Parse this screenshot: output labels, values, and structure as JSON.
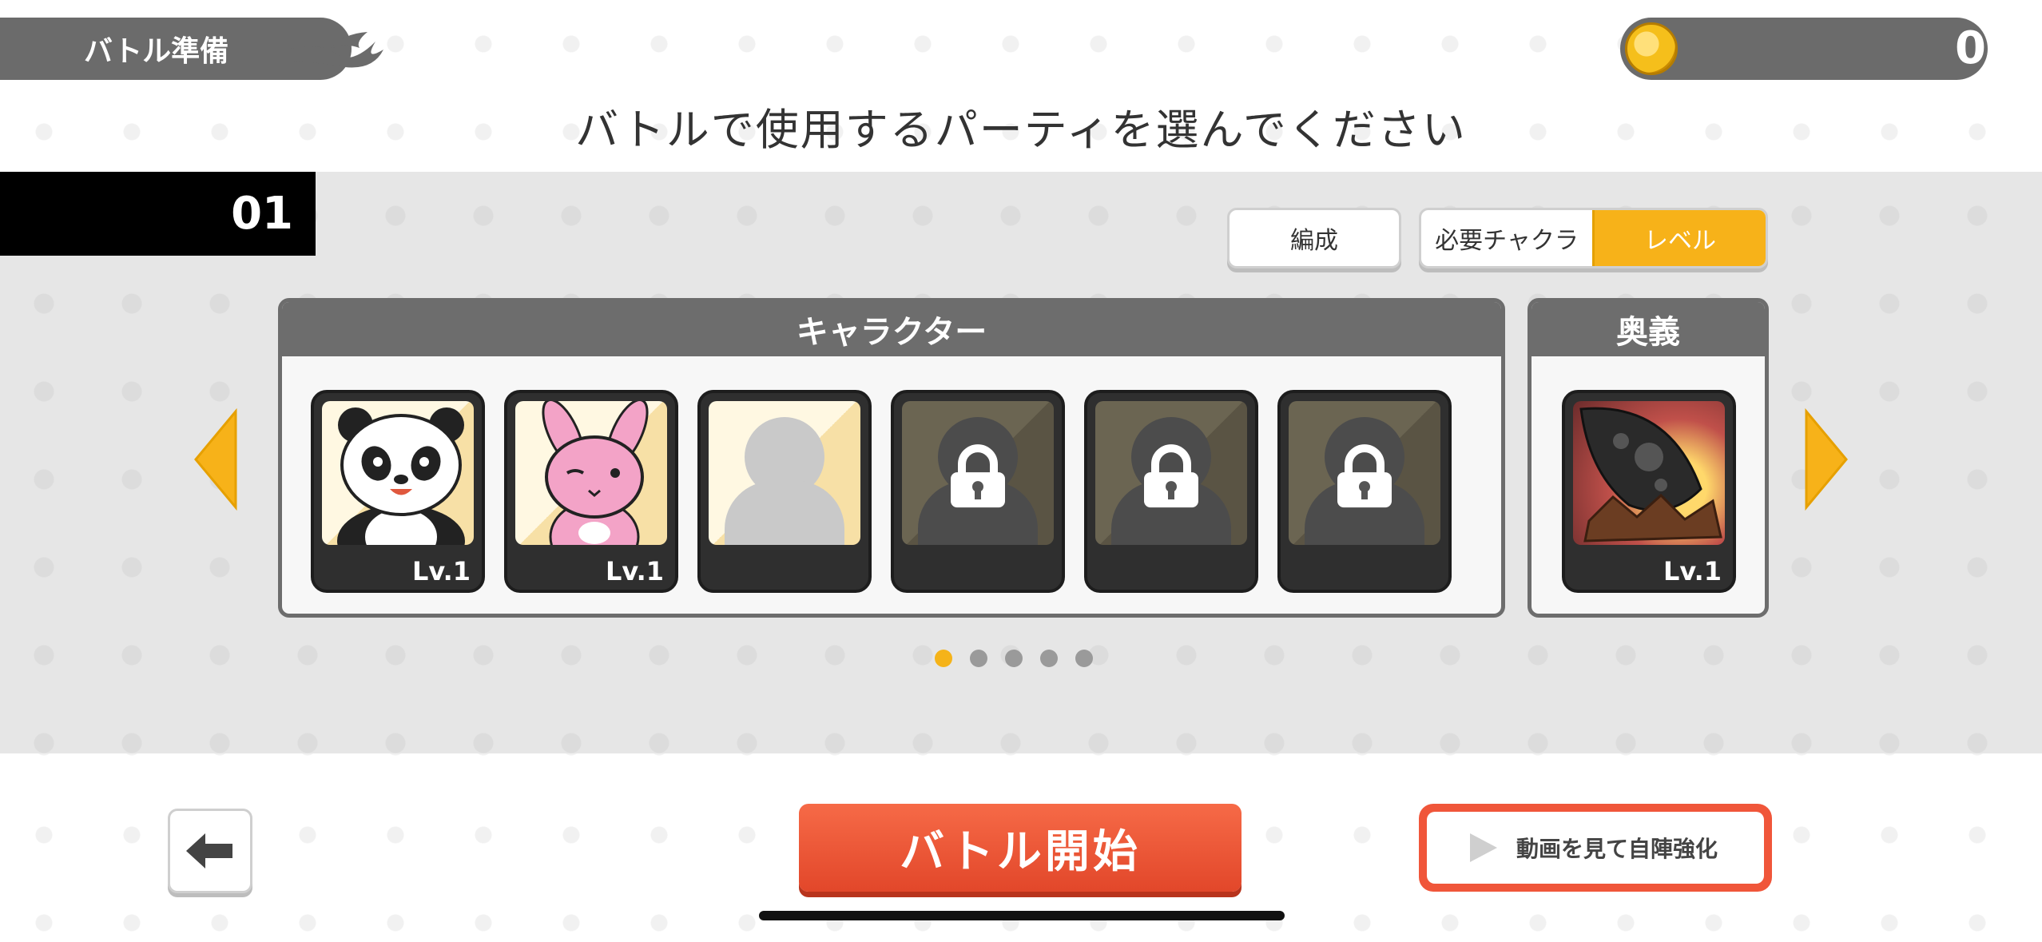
{
  "header": {
    "title": "バトル準備",
    "coins": "0"
  },
  "instruction": "バトルで使用するパーティを選んでください",
  "party": {
    "number": "01",
    "edit_label": "編成",
    "sort": {
      "options": [
        "必要チャクラ",
        "レベル"
      ],
      "active": "レベル"
    },
    "characters_header": "キャラクター",
    "ougi_header": "奥義",
    "slots": [
      {
        "state": "filled",
        "character": "panda",
        "level": "Lv.1"
      },
      {
        "state": "filled",
        "character": "pink-rabbit",
        "level": "Lv.1"
      },
      {
        "state": "empty"
      },
      {
        "state": "locked"
      },
      {
        "state": "locked"
      },
      {
        "state": "locked"
      }
    ],
    "ougi": {
      "state": "filled",
      "level": "Lv.1"
    },
    "page_count": 5,
    "current_page": 1
  },
  "footer": {
    "start_label": "バトル開始",
    "ad_label": "動画を見て自陣強化"
  },
  "colors": {
    "accent": "#f7b219",
    "start_button": "#e8502f",
    "header_gray": "#6b6b6b"
  }
}
